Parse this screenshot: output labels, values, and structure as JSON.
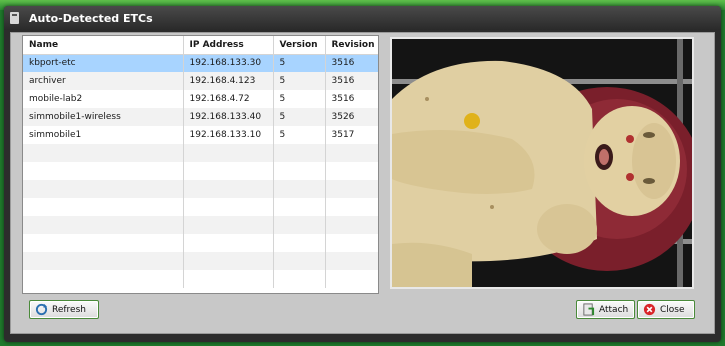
{
  "window": {
    "title": "Auto-Detected ETCs"
  },
  "table": {
    "columns": [
      "Name",
      "IP Address",
      "Version",
      "Revision"
    ],
    "rows": [
      {
        "name": "kbport-etc",
        "ip": "192.168.133.30",
        "version": "5",
        "revision": "3516",
        "selected": true
      },
      {
        "name": "archiver",
        "ip": "192.168.4.123",
        "version": "5",
        "revision": "3516",
        "selected": false
      },
      {
        "name": "mobile-lab2",
        "ip": "192.168.4.72",
        "version": "5",
        "revision": "3516",
        "selected": false
      },
      {
        "name": "simmobile1-wireless",
        "ip": "192.168.133.40",
        "version": "5",
        "revision": "3526",
        "selected": false
      },
      {
        "name": "simmobile1",
        "ip": "192.168.133.10",
        "version": "5",
        "revision": "3517",
        "selected": false
      }
    ],
    "empty_rows": 8
  },
  "buttons": {
    "refresh": "Refresh",
    "attach": "Attach",
    "close": "Close"
  },
  "colors": {
    "selection": "#a8d4ff",
    "background_green": "#1f7a2c",
    "close_icon": "#d9252a"
  },
  "icons": {
    "title": "device-icon",
    "refresh": "refresh-icon",
    "attach": "attach-icon",
    "close": "close-icon"
  }
}
